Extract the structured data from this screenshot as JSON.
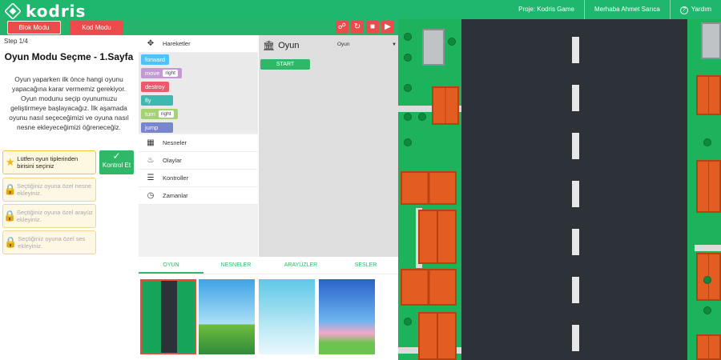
{
  "app": {
    "logo_text": "kodris",
    "project": "Proje: Kodris Game",
    "greeting": "Merhaba Ahmet Sarıca",
    "help": "Yardım"
  },
  "modes": {
    "block": "Blok Modu",
    "code": "Kod Modu"
  },
  "tools": {
    "share": "share-icon",
    "reset": "undo-icon",
    "save": "save-icon",
    "run": "play-icon"
  },
  "left": {
    "step": "Step 1/4",
    "title": "Oyun Modu Seçme - 1.Sayfa",
    "description": "Oyun yaparken ilk önce hangi oyunu yapacağına karar vermemiz gerekiyor. Oyun modunu seçip oyunumuzu geliştirmeye başlayacağız. İlk aşamada oyunu nasıl seçeceğimizi ve oyuna nasıl nesne ekleyeceğimizi öğreneceğiz.",
    "tasks": [
      "Lütfen oyun tiplerinden birisini seçiniz",
      "Seçtiğiniz oyuna özel nesne ekleyiniz.",
      "Seçtiğiniz oyuna özel arayüz ekleyiniz.",
      "Seçtiğiniz oyuna özel ses ekleyiniz."
    ],
    "check_label": "Kontrol Et"
  },
  "categories": {
    "movement": "Hareketler",
    "objects": "Nesneler",
    "events": "Olaylar",
    "controls": "Kontroller",
    "timers": "Zamanlar"
  },
  "blocks": [
    {
      "label": "forward",
      "color": "#4fc3f7"
    },
    {
      "label": "move",
      "option": "right",
      "color": "#c39bd3"
    },
    {
      "label": "destroy",
      "color": "#ec5b6b"
    },
    {
      "label": "fly",
      "color": "#3fb8af"
    },
    {
      "label": "turn",
      "option": "right",
      "color": "#a5d36f"
    },
    {
      "label": "jump",
      "color": "#7986cb"
    }
  ],
  "workspace": {
    "title": "Oyun",
    "select": "Oyun",
    "start": "START"
  },
  "bottom_tabs": [
    "OYUN",
    "NESNELER",
    "ARAYÜZLER",
    "SESLER"
  ]
}
